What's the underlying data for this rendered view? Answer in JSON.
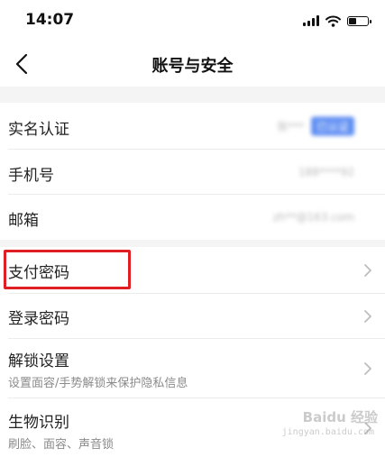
{
  "status_bar": {
    "time": "14:07"
  },
  "nav": {
    "title": "账号与安全"
  },
  "group1": [
    {
      "label": "实名认证",
      "value": "张*** ",
      "badge": "已认证"
    },
    {
      "label": "手机号",
      "value": "188****92"
    },
    {
      "label": "邮箱",
      "value": "zh**@163.com"
    }
  ],
  "group2": [
    {
      "label": "支付密码"
    },
    {
      "label": "登录密码"
    },
    {
      "label": "解锁设置",
      "sub": "设置面容/手势解锁来保护隐私信息"
    },
    {
      "label": "生物识别",
      "sub": "刷脸、面容、声音锁"
    }
  ],
  "watermark": {
    "brand": "Baidu 经验",
    "url": "jingyan.baidu.com"
  }
}
